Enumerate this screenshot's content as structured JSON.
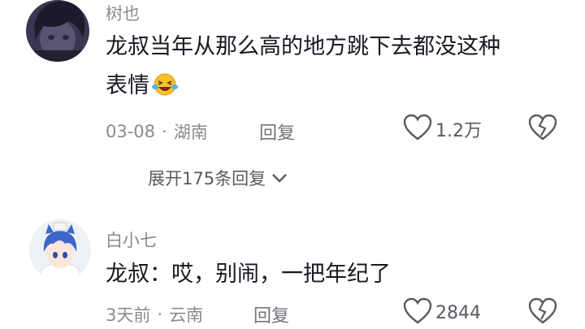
{
  "comments": [
    {
      "username": "树也",
      "text_line1": "龙叔当年从那么高的地方跳下去都没这种",
      "text_line2": "表情",
      "emoji": "laughing-crying-emoji",
      "date": "03-08",
      "location": "湖南",
      "dot": "·",
      "reply_label": "回复",
      "likes": "1.2万",
      "avatar_icon": "dark-anime-avatar"
    },
    {
      "username": "白小七",
      "text_line1": "龙叔：哎，别闹，一把年纪了",
      "date": "3天前",
      "location": "云南",
      "dot": "·",
      "reply_label": "回复",
      "likes": "2844",
      "avatar_icon": "blue-hair-anime-avatar"
    }
  ],
  "expand_replies": {
    "label": "展开175条回复",
    "icon": "chevron-down-icon"
  },
  "colors": {
    "username": "#8a8b91",
    "text": "#161823",
    "meta": "#8a8b91",
    "background": "#ffffff"
  }
}
